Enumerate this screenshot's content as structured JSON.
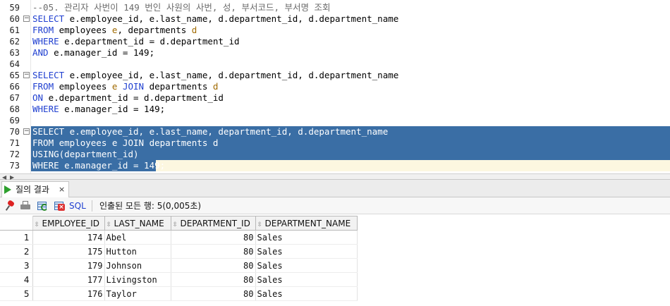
{
  "editor": {
    "lines": [
      {
        "n": "59",
        "fold": "",
        "html": "<span class=\"cm\">--05. 관리자 사번이 149 번인 사원의 사번, 성, 부서코드, 부서명 조회</span>"
      },
      {
        "n": "60",
        "fold": "⊟",
        "html": "<span class=\"kw\">SELECT</span> e.employee_id, e.last_name, d.department_id, d.department_name"
      },
      {
        "n": "61",
        "fold": "",
        "html": "<span class=\"kw\">FROM</span> employees <span class=\"alias\">e</span>, departments <span class=\"alias\">d</span>"
      },
      {
        "n": "62",
        "fold": "",
        "html": "<span class=\"kw\">WHERE</span> e.department_id = d.department_id"
      },
      {
        "n": "63",
        "fold": "",
        "html": "<span class=\"kw\">AND</span> e.manager_id = 149;"
      },
      {
        "n": "64",
        "fold": "",
        "html": ""
      },
      {
        "n": "65",
        "fold": "⊟",
        "html": "<span class=\"kw\">SELECT</span> e.employee_id, e.last_name, d.department_id, d.department_name"
      },
      {
        "n": "66",
        "fold": "",
        "html": "<span class=\"kw\">FROM</span> employees <span class=\"alias\">e</span> <span class=\"kw\">JOIN</span> departments <span class=\"alias\">d</span>"
      },
      {
        "n": "67",
        "fold": "",
        "html": "<span class=\"kw\">ON</span> e.department_id = d.department_id"
      },
      {
        "n": "68",
        "fold": "",
        "html": "<span class=\"kw\">WHERE</span> e.manager_id = 149;"
      },
      {
        "n": "69",
        "fold": "",
        "html": ""
      },
      {
        "n": "70",
        "fold": "⊟",
        "html": "SELECT e.employee_id, e.last_name, department_id, d.department_name"
      },
      {
        "n": "71",
        "fold": "",
        "html": "FROM employees e JOIN departments d"
      },
      {
        "n": "72",
        "fold": "",
        "html": "USING(department_id)"
      },
      {
        "n": "73",
        "fold": "",
        "html": "WHERE e.manager_id = 149;"
      }
    ],
    "selected_lines": [
      "70",
      "71",
      "72",
      "73"
    ]
  },
  "results": {
    "tab_label": "질의 결과",
    "tab_close": "×",
    "sql_label": "SQL",
    "status": "인출된 모든 행: 5(0,005초)",
    "columns": [
      "EMPLOYEE_ID",
      "LAST_NAME",
      "DEPARTMENT_ID",
      "DEPARTMENT_NAME"
    ],
    "rows": [
      {
        "rn": "1",
        "employee_id": "174",
        "last_name": "Abel",
        "department_id": "80",
        "department_name": "Sales"
      },
      {
        "rn": "2",
        "employee_id": "175",
        "last_name": "Hutton",
        "department_id": "80",
        "department_name": "Sales"
      },
      {
        "rn": "3",
        "employee_id": "179",
        "last_name": "Johnson",
        "department_id": "80",
        "department_name": "Sales"
      },
      {
        "rn": "4",
        "employee_id": "177",
        "last_name": "Livingston",
        "department_id": "80",
        "department_name": "Sales"
      },
      {
        "rn": "5",
        "employee_id": "176",
        "last_name": "Taylor",
        "department_id": "80",
        "department_name": "Sales"
      }
    ]
  },
  "icons": {
    "tab": "run-result-icon",
    "pin": "pin-icon",
    "print": "printer-icon",
    "refresh": "refresh-grid-icon",
    "cancel": "cancel-grid-icon",
    "sort": "sort-icon"
  },
  "colors": {
    "selection": "#3a6ea5",
    "keyword": "#1f3fd0",
    "current_line": "#fcf7e0"
  }
}
